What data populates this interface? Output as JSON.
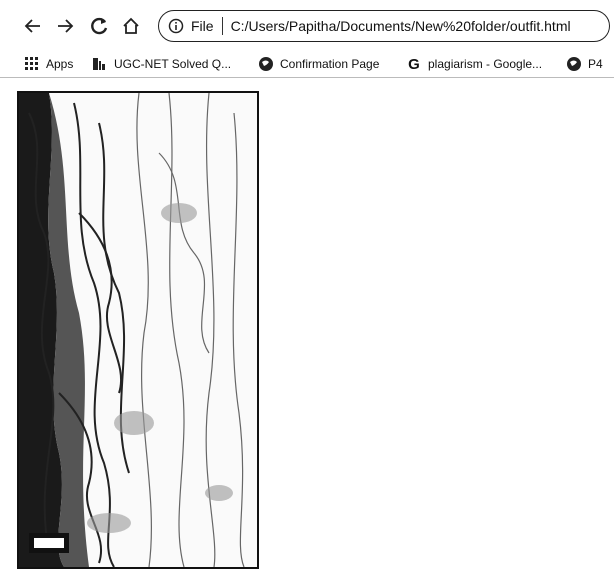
{
  "browser": {
    "nav": {
      "back_icon": "arrow-left-icon",
      "forward_icon": "arrow-right-icon",
      "reload_icon": "reload-icon",
      "home_icon": "home-icon"
    },
    "omnibox": {
      "scheme_label": "File",
      "url": "C:/Users/Papitha/Documents/New%20folder/outfit.html"
    },
    "bookmarks": [
      {
        "label": "Apps",
        "icon": "apps-grid-icon"
      },
      {
        "label": "UGC-NET Solved Q...",
        "icon": "book-icon"
      },
      {
        "label": "Confirmation Page",
        "icon": "globe-icon"
      },
      {
        "label": "plagiarism - Google...",
        "icon": "google-icon"
      },
      {
        "label": "P4",
        "icon": "globe-icon"
      }
    ]
  },
  "page": {
    "image": {
      "description": "",
      "border_color": "#111111"
    }
  }
}
